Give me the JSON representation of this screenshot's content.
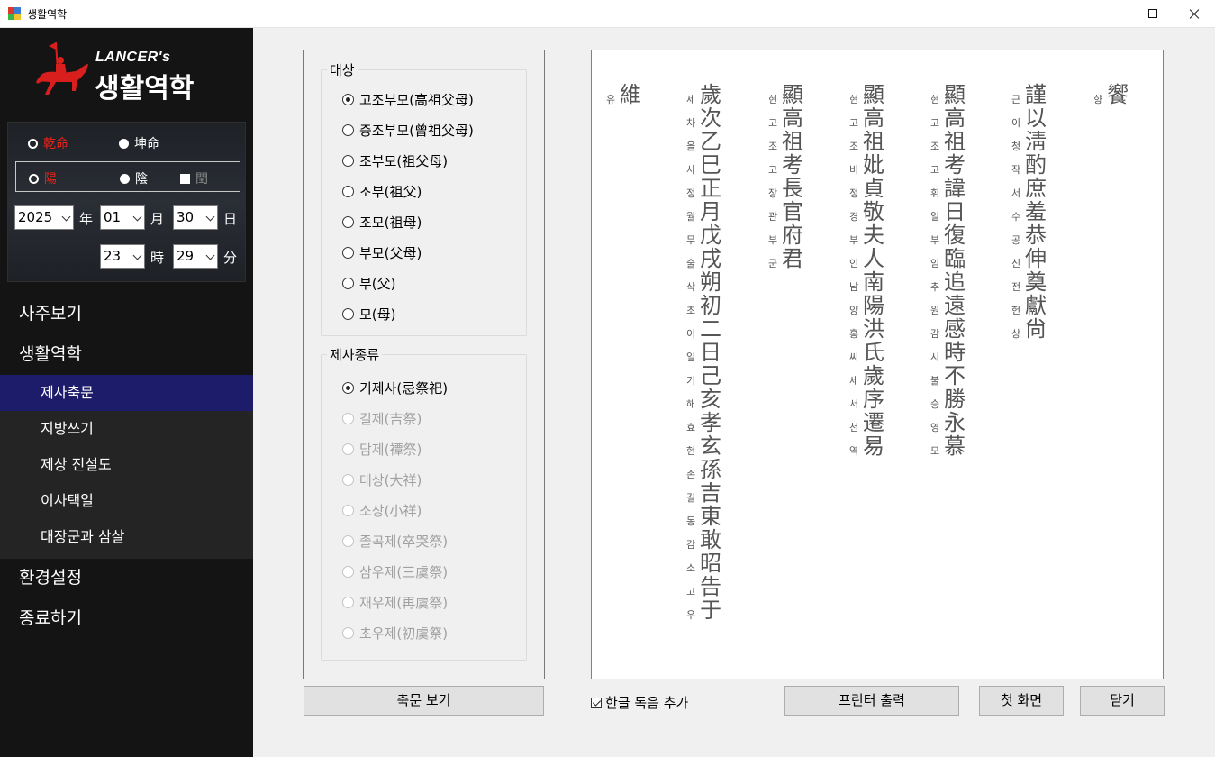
{
  "window": {
    "title": "생활역학"
  },
  "logo": {
    "brand": "LANCER's",
    "app_name": "생활역학"
  },
  "birth": {
    "gender": {
      "male_label": "乾命",
      "female_label": "坤命",
      "selected": "male"
    },
    "calendar": {
      "yang_label": "陽",
      "eum_label": "陰",
      "leap_label": "閏",
      "selected": "yang",
      "leap_checked": false
    },
    "year": "2025",
    "year_unit": "年",
    "month": "01",
    "month_unit": "月",
    "day": "30",
    "day_unit": "日",
    "hour": "23",
    "hour_unit": "時",
    "minute": "29",
    "minute_unit": "分"
  },
  "menu": {
    "top": [
      "사주보기",
      "생활역학"
    ],
    "sub": [
      "제사축문",
      "지방쓰기",
      "제상 진설도",
      "이사택일",
      "대장군과 삼살"
    ],
    "active_sub": "제사축문",
    "bottom": [
      "환경설정",
      "종료하기"
    ]
  },
  "target_group": {
    "title": "대상",
    "options": [
      "고조부모(高祖父母)",
      "증조부모(曾祖父母)",
      "조부모(祖父母)",
      "조부(祖父)",
      "조모(祖母)",
      "부모(父母)",
      "부(父)",
      "모(母)"
    ],
    "selected": "고조부모(高祖父母)"
  },
  "ritual_group": {
    "title": "제사종류",
    "options": [
      "기제사(忌祭祀)",
      "길제(吉祭)",
      "담제(禫祭)",
      "대상(大祥)",
      "소상(小祥)",
      "졸곡제(卒哭祭)",
      "삼우제(三虞祭)",
      "재우제(再虞祭)",
      "초우제(初虞祭)"
    ],
    "selected": "기제사(忌祭祀)",
    "enabled": [
      "기제사(忌祭祀)"
    ]
  },
  "buttons": {
    "view": "축문 보기",
    "print": "프린터 출력",
    "home": "첫 화면",
    "close": "닫기"
  },
  "hangul_reading": {
    "label": "한글 독음 추가",
    "checked": true
  },
  "chukmun": {
    "columns": [
      {
        "hanja": "維",
        "hangul": "유"
      },
      {
        "hanja": "歲次乙巳正月戊戌朔初二日己亥孝玄孫吉東敢昭告于",
        "hangul": "세차을사정월무술삭초이일기해효현손길동감소고우"
      },
      {
        "hanja": "顯高祖考長官府君",
        "hangul": "현고조고장관부군"
      },
      {
        "hanja": "顯高祖妣貞敬夫人南陽洪氏歲序遷易",
        "hangul": "현고조비정경부인남양홍씨세서천역"
      },
      {
        "hanja": "顯高祖考諱日復臨追遠感時不勝永慕",
        "hangul": "현고조고휘일부임추원감시불승영모"
      },
      {
        "hanja": "謹以淸酌庶羞恭伸奠獻尙",
        "hangul": "근이청작서수공신전헌상"
      },
      {
        "hanja": "饗",
        "hangul": "향"
      }
    ]
  }
}
